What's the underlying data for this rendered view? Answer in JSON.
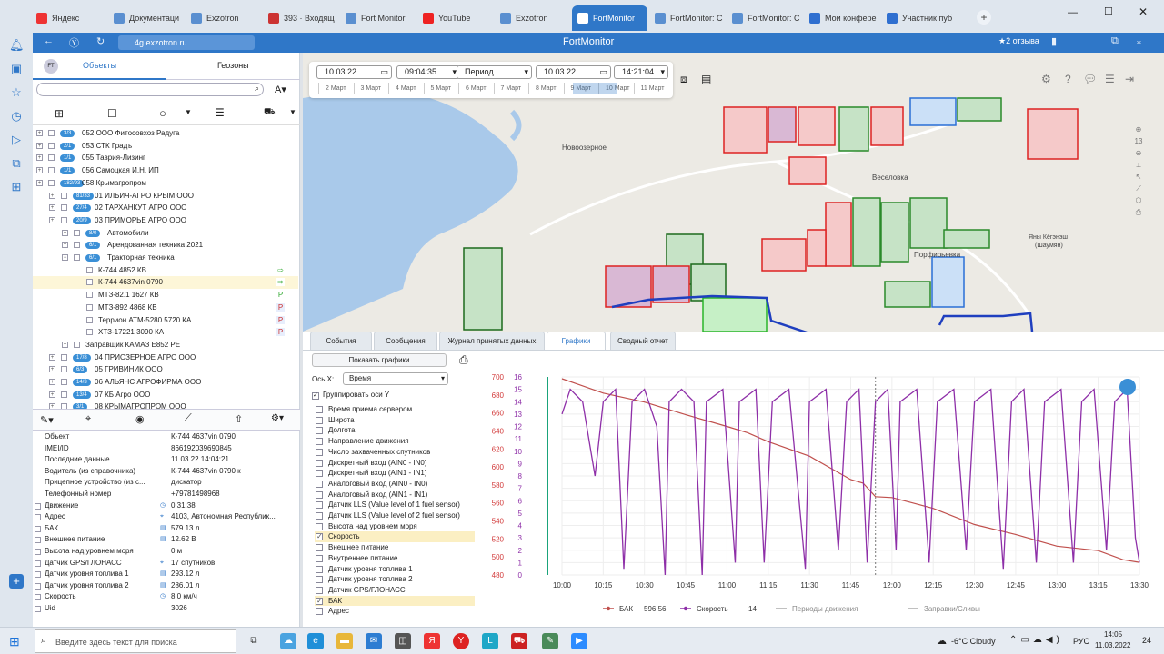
{
  "browser": {
    "tabs": [
      {
        "label": "Яндекс",
        "icon_color": "#e33"
      },
      {
        "label": "Документаци",
        "icon_color": "#5a8fd0"
      },
      {
        "label": "Exzotron",
        "icon_color": "#5a8fd0"
      },
      {
        "label": "393 · Входящ",
        "icon_color": "#c33"
      },
      {
        "label": "Fort Monitor",
        "icon_color": "#5a8fd0"
      },
      {
        "label": "YouTube",
        "icon_color": "#e22"
      },
      {
        "label": "Exzotron",
        "icon_color": "#5a8fd0"
      },
      {
        "label": "FortMonitor",
        "icon_color": "#ffffff"
      },
      {
        "label": "FortMonitor: С",
        "icon_color": "#5a8fd0"
      },
      {
        "label": "FortMonitor: С",
        "icon_color": "#5a8fd0"
      },
      {
        "label": "Мои конфере",
        "icon_color": "#2f6fd0"
      },
      {
        "label": "Участник пуб",
        "icon_color": "#2f6fd0"
      }
    ],
    "url": "4g.exzotron.ru",
    "page_title": "FortMonitor",
    "reviews": "★2 отзыва"
  },
  "left_panel": {
    "tab_objects": "Объекты",
    "tab_geozones": "Геозоны",
    "tree": [
      {
        "badge": "3/3",
        "label": "052 ООО Фитосовхоз Радуга",
        "level": 0
      },
      {
        "badge": "2/1",
        "label": "053 СТК Градъ",
        "level": 0
      },
      {
        "badge": "1/1",
        "label": "055 Таврия-Лизинг",
        "level": 0
      },
      {
        "badge": "1/1",
        "label": "056 Самоцкая И.Н. ИП",
        "level": 0
      },
      {
        "badge": "182/93",
        "label": "058 Крымагропром",
        "level": 0
      },
      {
        "badge": "81/33",
        "label": "01 ИЛЬИЧ-АГРО КРЫМ ООО",
        "level": 1
      },
      {
        "badge": "27/4",
        "label": "02 ТАРХАНКУТ АГРО ООО",
        "level": 1
      },
      {
        "badge": "20/9",
        "label": "03 ПРИМОРЬЕ АГРО ООО",
        "level": 1
      },
      {
        "badge": "8/0",
        "label": "Автомобили",
        "level": 2
      },
      {
        "badge": "6/1",
        "label": "Арендованная техника 2021",
        "level": 2
      },
      {
        "badge": "6/1",
        "label": "Тракторная техника",
        "level": 2
      },
      {
        "badge": "",
        "label": "К-744 4852 КВ",
        "level": 3
      },
      {
        "badge": "",
        "label": "К-744 4637vin 0790",
        "level": 3,
        "selected": true
      },
      {
        "badge": "",
        "label": "МТЗ-82.1 1627 КВ",
        "level": 3
      },
      {
        "badge": "",
        "label": "МТЗ-892 4868 КВ",
        "level": 3
      },
      {
        "badge": "",
        "label": "Террион АТМ-5280 5720 КА",
        "level": 3
      },
      {
        "badge": "",
        "label": "ХТЗ-17221 3090 КА",
        "level": 3
      },
      {
        "badge": "",
        "label": "Заправщик КАМАЗ Е852 РЕ",
        "level": 2
      },
      {
        "badge": "17/8",
        "label": "04 ПРИОЗЕРНОЕ АГРО ООО",
        "level": 1
      },
      {
        "badge": "6/3",
        "label": "05 ГРИВИНИК ООО",
        "level": 1
      },
      {
        "badge": "14/3",
        "label": "06 АЛЬЯНС АГРОФИРМА ООО",
        "level": 1
      },
      {
        "badge": "13/4",
        "label": "07 КБ Агро ООО",
        "level": 1
      },
      {
        "badge": "3/1",
        "label": "08 КРЫМАГРОПРОМ ООО",
        "level": 1
      }
    ],
    "props": [
      {
        "k": "Объект",
        "v": "К-744 4637vin 0790",
        "icon": ""
      },
      {
        "k": "IMEI/ID",
        "v": "866192039690845",
        "icon": ""
      },
      {
        "k": "Последние данные",
        "v": "11.03.22 14:04:21",
        "icon": ""
      },
      {
        "k": "Водитель (из справочника)",
        "v": "К-744 4637vin 0790 к",
        "icon": ""
      },
      {
        "k": "Прицепное устройство (из с...",
        "v": "дискатор",
        "icon": ""
      },
      {
        "k": "Телефонный номер",
        "v": "+79781498968",
        "icon": ""
      },
      {
        "k": "Движение",
        "v": "0:31:38",
        "icon": "◷"
      },
      {
        "k": "Адрес",
        "v": "4103, Автономная Республик...",
        "icon": "⌖"
      },
      {
        "k": "БАК",
        "v": "579.13 л",
        "icon": "▤"
      },
      {
        "k": "Внешнее питание",
        "v": "12.62 В",
        "icon": "▤"
      },
      {
        "k": "Высота над уровнем моря",
        "v": "0 м",
        "icon": ""
      },
      {
        "k": "Датчик GPS/ГЛОНАСС",
        "v": "17 спутников",
        "icon": "⌖"
      },
      {
        "k": "Датчик уровня топлива 1",
        "v": "293.12 л",
        "icon": "▤"
      },
      {
        "k": "Датчик уровня топлива 2",
        "v": "286.01 л",
        "icon": "▤"
      },
      {
        "k": "Скорость",
        "v": "8.0 км/ч",
        "icon": "◷"
      },
      {
        "k": "Uid",
        "v": "3026",
        "icon": ""
      }
    ]
  },
  "datebar": {
    "date_from": "10.03.22",
    "time_from": "09:04:35",
    "period": "Период",
    "date_to": "10.03.22",
    "time_to": "14:21:04",
    "days": [
      "2 Март",
      "3 Март",
      "4 Март",
      "5 Март",
      "6 Март",
      "7 Март",
      "8 Март",
      "9 Март",
      "10 Март",
      "11 Март"
    ]
  },
  "map_labels": {
    "town1": "Новоозерное",
    "town2": "Веселовка",
    "town3": "Порфирьевка",
    "town4": "Яны Кёгэнэш\n(Шаумян)"
  },
  "bottom": {
    "tabs": [
      "События",
      "Сообщения",
      "Журнал принятых данных",
      "Графики",
      "Сводный отчет"
    ],
    "active_tab": 3,
    "show_charts": "Показать графики",
    "axis_x_label": "Ось Х:",
    "axis_x_value": "Время",
    "group_y": "Группировать оси Y",
    "params": [
      {
        "label": "Время приема сервером",
        "on": false
      },
      {
        "label": "Широта",
        "on": false
      },
      {
        "label": "Долгота",
        "on": false
      },
      {
        "label": "Направление движения",
        "on": false
      },
      {
        "label": "Число захваченных спутников",
        "on": false
      },
      {
        "label": "Дискретный вход (AIN0 - IN0)",
        "on": false
      },
      {
        "label": "Дискретный вход (AIN1 - IN1)",
        "on": false
      },
      {
        "label": "Аналоговый вход (AIN0 - IN0)",
        "on": false
      },
      {
        "label": "Аналоговый вход (AIN1 - IN1)",
        "on": false
      },
      {
        "label": "Датчик LLS (Value level of 1 fuel sensor)",
        "on": false
      },
      {
        "label": "Датчик LLS (Value level of 2 fuel sensor)",
        "on": false
      },
      {
        "label": "Высота над уровнем моря",
        "on": false
      },
      {
        "label": "Скорость",
        "on": true
      },
      {
        "label": "Внешнее питание",
        "on": false
      },
      {
        "label": "Внутреннее питание",
        "on": false
      },
      {
        "label": "Датчик уровня топлива 1",
        "on": false
      },
      {
        "label": "Датчик уровня топлива 2",
        "on": false
      },
      {
        "label": "Датчик GPS/ГЛОНАСС",
        "on": false
      },
      {
        "label": "БАК",
        "on": true
      },
      {
        "label": "Адрес",
        "on": false
      }
    ]
  },
  "chart_data": {
    "type": "line",
    "x": [
      "10:00",
      "10:15",
      "10:30",
      "10:45",
      "11:00",
      "11:15",
      "11:30",
      "11:45",
      "12:00",
      "12:15",
      "12:30",
      "12:45",
      "13:00",
      "13:15",
      "13:30"
    ],
    "y_left": {
      "ticks": [
        480,
        500,
        520,
        540,
        560,
        580,
        600,
        620,
        640,
        660,
        680,
        700
      ],
      "color": "#d23a3a"
    },
    "y_right": {
      "ticks": [
        0,
        1,
        2,
        3,
        4,
        5,
        6,
        7,
        8,
        9,
        10,
        11,
        12,
        13,
        14,
        15,
        16
      ],
      "color": "#8e2fa8"
    },
    "series": [
      {
        "name": "БАК",
        "axis": "left",
        "color": "#c0504d",
        "legend_value": "596,56",
        "points": [
          [
            0,
            698
          ],
          [
            1,
            682
          ],
          [
            2,
            672
          ],
          [
            3,
            658
          ],
          [
            4,
            645
          ],
          [
            4.5,
            638
          ],
          [
            5,
            628
          ],
          [
            6,
            612
          ],
          [
            7,
            586
          ],
          [
            7.3,
            582
          ],
          [
            7.6,
            567
          ],
          [
            8,
            566
          ],
          [
            8.5,
            560
          ],
          [
            9,
            554
          ],
          [
            10,
            536
          ],
          [
            11,
            525
          ],
          [
            12,
            512
          ],
          [
            13,
            507
          ],
          [
            13.6,
            497
          ],
          [
            14,
            494
          ]
        ]
      },
      {
        "name": "Скорость",
        "axis": "right",
        "color": "#8e2fa8",
        "legend_value": "14",
        "points": [
          [
            0,
            13
          ],
          [
            0.2,
            15
          ],
          [
            0.5,
            14
          ],
          [
            0.8,
            8
          ],
          [
            1,
            14
          ],
          [
            1.3,
            15
          ],
          [
            1.5,
            0.5
          ],
          [
            1.7,
            14
          ],
          [
            2,
            15
          ],
          [
            2.3,
            12
          ],
          [
            2.5,
            0
          ],
          [
            2.6,
            14
          ],
          [
            2.9,
            15
          ],
          [
            3.2,
            14
          ],
          [
            3.4,
            0
          ],
          [
            3.5,
            14
          ],
          [
            3.9,
            15
          ],
          [
            4.2,
            1
          ],
          [
            4.3,
            14
          ],
          [
            4.7,
            15
          ],
          [
            4.9,
            1
          ],
          [
            5.1,
            14
          ],
          [
            5.5,
            15
          ],
          [
            5.9,
            0.5
          ],
          [
            6,
            14
          ],
          [
            6.4,
            15
          ],
          [
            6.7,
            2
          ],
          [
            6.9,
            14
          ],
          [
            7.2,
            15
          ],
          [
            7.4,
            1
          ],
          [
            7.6,
            14
          ],
          [
            7.9,
            15
          ],
          [
            8.1,
            2
          ],
          [
            8.2,
            14
          ],
          [
            8.6,
            15
          ],
          [
            8.9,
            1
          ],
          [
            9.1,
            14
          ],
          [
            9.5,
            15
          ],
          [
            9.8,
            2
          ],
          [
            10,
            14
          ],
          [
            10.4,
            15
          ],
          [
            10.7,
            0.5
          ],
          [
            10.9,
            14
          ],
          [
            11.2,
            15
          ],
          [
            11.5,
            1
          ],
          [
            11.7,
            14
          ],
          [
            12.1,
            15
          ],
          [
            12.4,
            1
          ],
          [
            12.6,
            14
          ],
          [
            12.9,
            15
          ],
          [
            13.2,
            2
          ],
          [
            13.4,
            14
          ],
          [
            13.7,
            15
          ],
          [
            13.9,
            3
          ],
          [
            14,
            1
          ]
        ]
      }
    ],
    "legend_extra": [
      "Периоды движения",
      "Заправки/Сливы"
    ],
    "cursor_x": 7.6
  },
  "taskbar": {
    "search_placeholder": "Введите здесь текст для поиска",
    "weather": "-6°C Cloudy",
    "lang": "РУС",
    "time": "14:05",
    "date": "11.03.2022",
    "notif": "24"
  }
}
